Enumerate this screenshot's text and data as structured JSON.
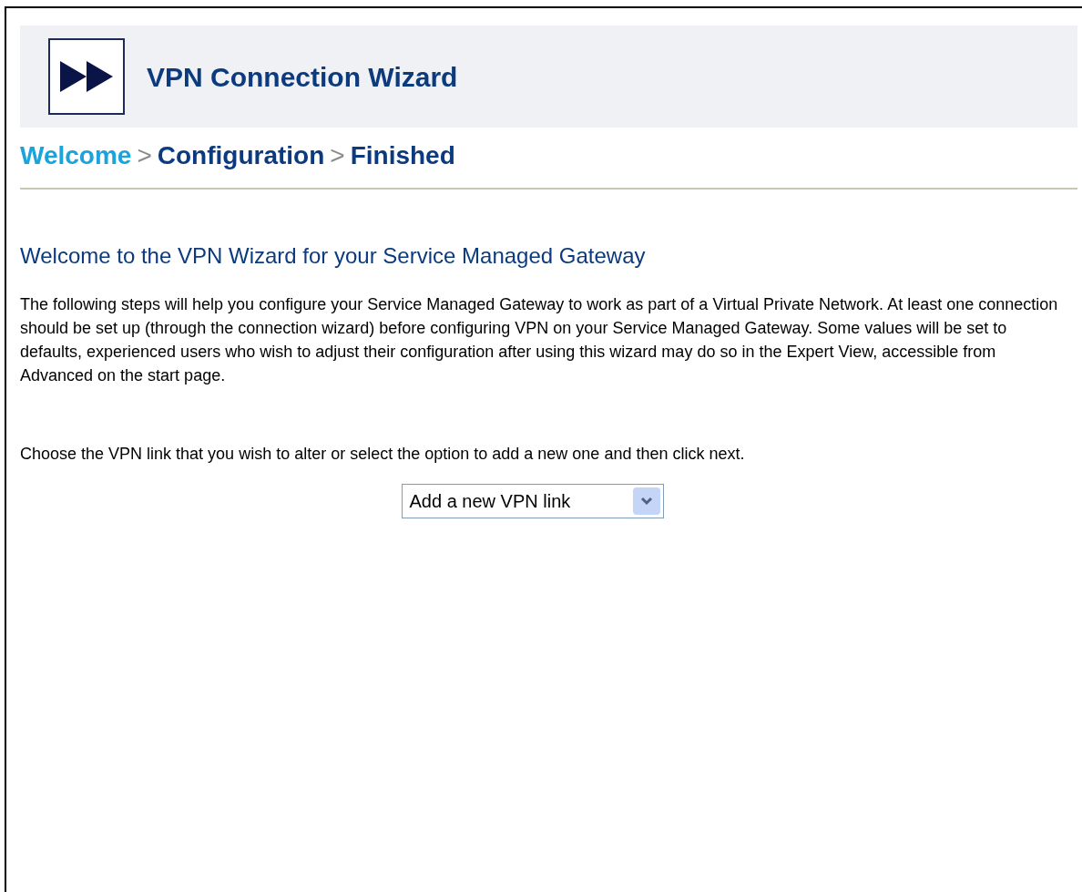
{
  "header": {
    "title": "VPN Connection Wizard"
  },
  "breadcrumb": {
    "separator": ">",
    "steps": [
      {
        "label": "Welcome",
        "selected": true
      },
      {
        "label": "Configuration",
        "selected": false
      },
      {
        "label": "Finished",
        "selected": false
      }
    ]
  },
  "heading": "Welcome to the VPN Wizard for your Service Managed Gateway",
  "paragraphs": [
    "The following steps will help you configure your Service Managed Gateway to work as part of a Virtual Private Network. At least one connection should be set up (through the connection wizard) before configuring VPN on your Service Managed Gateway. Some values will be set to defaults, experienced users who wish to adjust their configuration after using this wizard may do so in the Expert View, accessible from Advanced on the start page.",
    "Choose the VPN link that you wish to alter or select the option to add a new one and then click next."
  ],
  "select": {
    "value": "Add a new VPN link"
  }
}
